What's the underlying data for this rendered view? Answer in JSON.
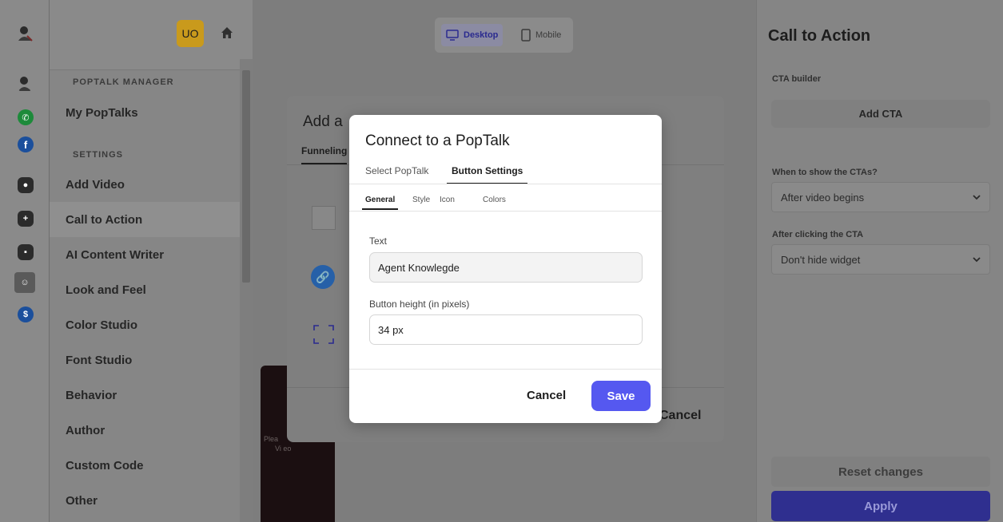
{
  "header": {
    "user_initials": "UO",
    "device_tabs": [
      {
        "label": "Desktop",
        "active": true
      },
      {
        "label": "Mobile",
        "active": false
      }
    ]
  },
  "sidebar": {
    "section_manager": "POPTALK MANAGER",
    "section_settings": "SETTINGS",
    "manager_items": [
      {
        "label": "My PopTalks"
      }
    ],
    "items": [
      {
        "label": "Add Video"
      },
      {
        "label": "Call to Action",
        "active": true
      },
      {
        "label": "AI Content Writer"
      },
      {
        "label": "Look and Feel"
      },
      {
        "label": "Color Studio"
      },
      {
        "label": "Font Studio"
      },
      {
        "label": "Behavior"
      },
      {
        "label": "Author"
      },
      {
        "label": "Custom Code"
      },
      {
        "label": "Other"
      }
    ]
  },
  "icon_rail": [
    {
      "icon": "brand-logo-icon",
      "color": "#2a2a2a"
    },
    {
      "icon": "whatsapp-icon",
      "color": "#1d8a3a"
    },
    {
      "icon": "facebook-icon",
      "color": "#1b4f9c"
    },
    {
      "icon": "contact-icon",
      "color": "#2b2b2b"
    },
    {
      "icon": "add-widget-icon",
      "color": "#2b2b2b"
    },
    {
      "icon": "chat-icon",
      "color": "#2b2b2b"
    },
    {
      "icon": "mascot-icon",
      "color": "#3a3a3a"
    },
    {
      "icon": "dollar-icon",
      "color": "#1b4f9c"
    }
  ],
  "preview": {
    "text_line1": "Plea",
    "text_line2": "Vi  eo"
  },
  "outer_modal": {
    "title": "Add a",
    "tab": "Funneling",
    "cancel_label": "Cancel"
  },
  "dialog": {
    "title": "Connect to a PopTalk",
    "tabs": [
      {
        "label": "Select PopTalk",
        "active": false
      },
      {
        "label": "Button Settings",
        "active": true
      }
    ],
    "subtabs": [
      {
        "label": "General",
        "active": true
      },
      {
        "label": "Style",
        "active": false
      },
      {
        "label": "Icon",
        "active": false
      },
      {
        "label": "Colors",
        "active": false
      }
    ],
    "text_label": "Text",
    "text_value": "Agent Knowlegde",
    "height_label": "Button height (in pixels)",
    "height_value": "34 px",
    "cancel_label": "Cancel",
    "save_label": "Save",
    "accent_color": "#5558f0"
  },
  "right_panel": {
    "title": "Call to Action",
    "cta_builder_label": "CTA builder",
    "add_cta_label": "Add CTA",
    "when_label": "When to show the CTAs?",
    "when_value": "After video begins",
    "after_click_label": "After clicking the CTA",
    "after_click_value": "Don't hide widget",
    "reset_label": "Reset changes",
    "apply_label": "Apply"
  }
}
